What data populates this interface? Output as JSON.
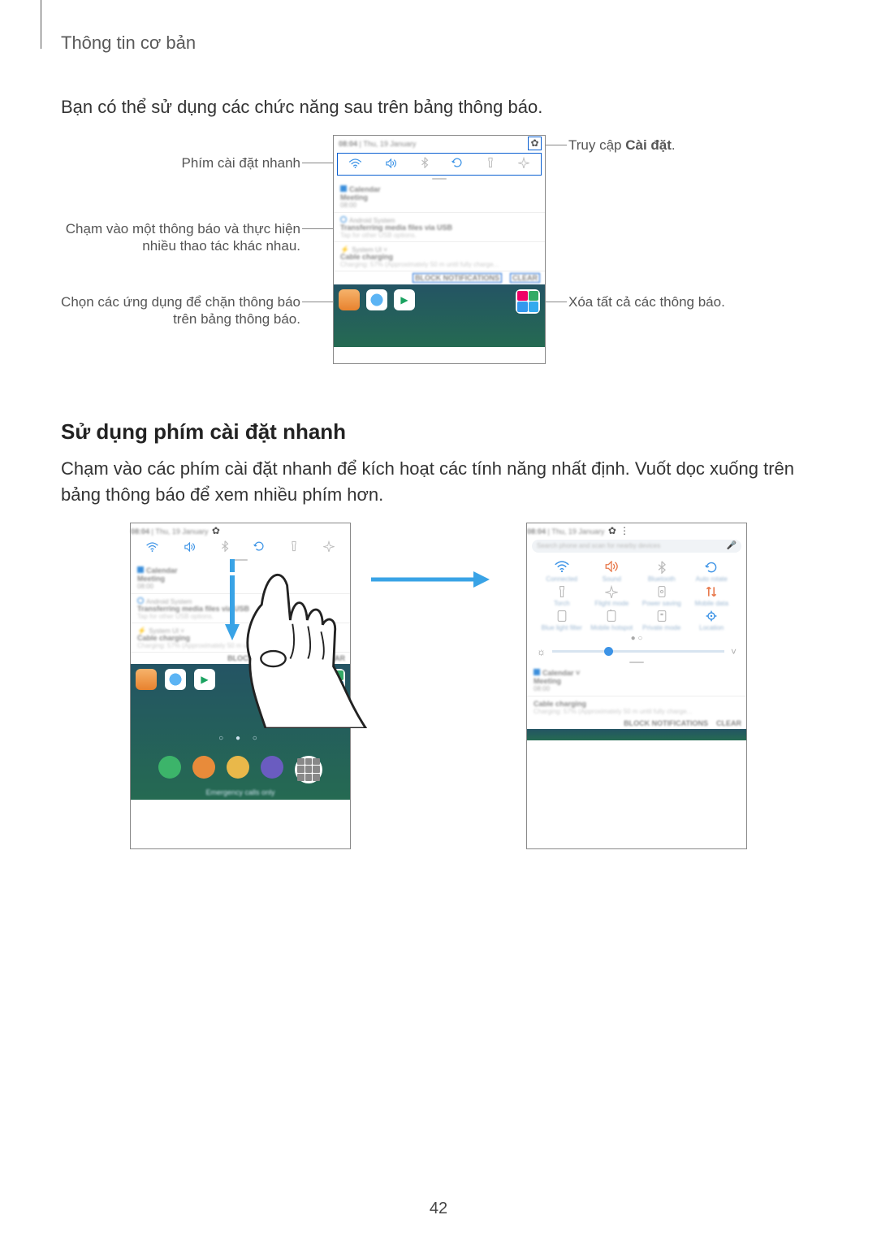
{
  "header": "Thông tin cơ bản",
  "intro": "Bạn có thể sử dụng các chức năng sau trên bảng thông báo.",
  "subheading": "Sử dụng phím cài đặt nhanh",
  "body2": "Chạm vào các phím cài đặt nhanh để kích hoạt các tính năng nhất định. Vuốt dọc xuống trên bảng thông báo để xem nhiều phím hơn.",
  "page_number": "42",
  "callouts": {
    "left1": "Phím cài đặt nhanh",
    "left2": "Chạm vào một thông báo và thực hiện nhiều thao tác khác nhau.",
    "left3": "Chọn các ứng dụng để chặn thông báo trên bảng thông báo.",
    "right1_pre": "Truy cập ",
    "right1_bold": "Cài đặt",
    "right1_post": ".",
    "right2": "Xóa tất cả các thông báo."
  },
  "phone": {
    "time": "08:04",
    "date": "Thu, 19 January",
    "system_label": "Android System",
    "calendar_label": "Calendar",
    "meeting": "Meeting",
    "meeting_time": "08:00",
    "usb_title": "Transferring media files via USB",
    "usb_sub": "Tap for other USB options.",
    "systemui": "System UI",
    "cable_charging": "Cable charging",
    "charging_sub": "Charging: 57% (Approximately 50 m until fully charge...",
    "block": "BLOCK NOTIFICATIONS",
    "clear": "CLEAR",
    "search_placeholder": "Search phone and scan for nearby devices",
    "emergency": "Emergency calls only"
  },
  "qs_labels": {
    "r1": [
      "Connected",
      "Sound",
      "Bluetooth",
      "Auto rotate"
    ],
    "r2": [
      "Torch",
      "Flight mode",
      "Power saving",
      "Mobile data"
    ],
    "r3": [
      "Blue light filter",
      "Mobile hotspot",
      "Private mode",
      "Location"
    ]
  }
}
